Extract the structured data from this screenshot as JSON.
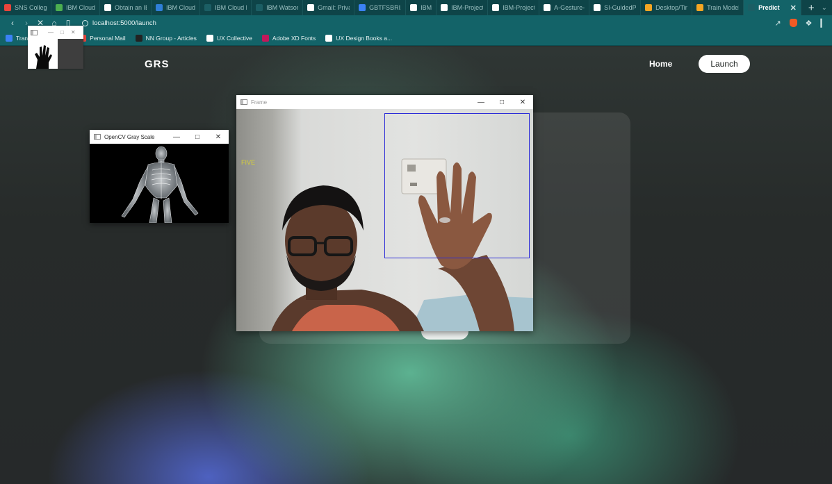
{
  "tabs": [
    {
      "label": "SNS College",
      "color": "#e8453c"
    },
    {
      "label": "IBM Cloud",
      "color": "#4caf50"
    },
    {
      "label": "Obtain an IB",
      "color": "#ffffff"
    },
    {
      "label": "IBM Cloud",
      "color": "#2f7fd8"
    },
    {
      "label": "IBM Cloud F",
      "color": "#1b5e64"
    },
    {
      "label": "IBM Watson",
      "color": "#1b5e64"
    },
    {
      "label": "Gmail: Priva",
      "color": "#ffffff"
    },
    {
      "label": "GBTFSBRI1",
      "color": "#3b82f6"
    },
    {
      "label": "IBM",
      "color": "#ffffff"
    },
    {
      "label": "IBM-Project",
      "color": "#ffffff"
    },
    {
      "label": "IBM-Project",
      "color": "#ffffff"
    },
    {
      "label": "A-Gesture-",
      "color": "#ffffff"
    },
    {
      "label": "SI-GuidedP",
      "color": "#ffffff"
    },
    {
      "label": "Desktop/Tin",
      "color": "#f5a623"
    },
    {
      "label": "Train Model",
      "color": "#f5a623"
    },
    {
      "label": "Predict",
      "color": "#1b5e64",
      "active": true
    }
  ],
  "url": "localhost:5000/launch",
  "bookmarks": [
    {
      "label": "Tran",
      "color": "#3b82f6"
    },
    {
      "label": "Personal Mail",
      "color": "#e8453c"
    },
    {
      "label": "NN Group - Articles",
      "color": "#222222"
    },
    {
      "label": "UX Collective",
      "color": "#ffffff"
    },
    {
      "label": "Adobe XD Fonts",
      "color": "#c2185b"
    },
    {
      "label": "UX Design Books a...",
      "color": "#ffffff"
    }
  ],
  "site": {
    "logo": "GRS",
    "nav_home": "Home",
    "launch_button": "Launch"
  },
  "gray_window": {
    "title": "OpenCV Gray Scale"
  },
  "frame_window": {
    "title": "Frame",
    "prediction": "FIVE"
  },
  "colors": {
    "tab_bar": "#0e4448",
    "toolbar": "#136368",
    "roi_box": "#2b2bd8",
    "prediction_text": "#d6cf3a"
  }
}
